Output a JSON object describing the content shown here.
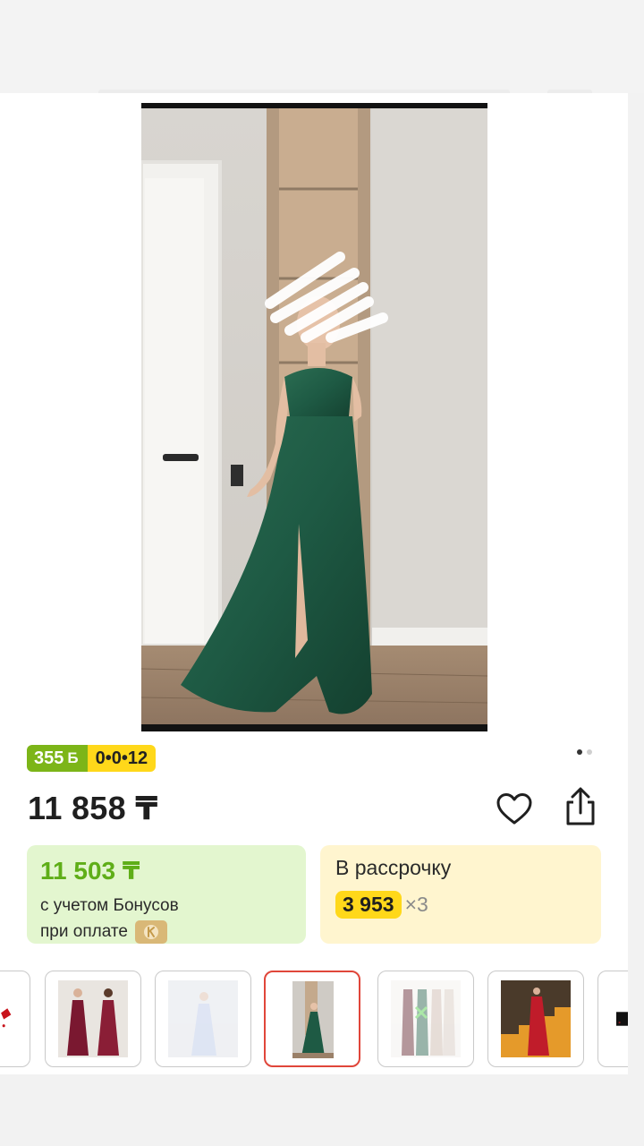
{
  "product": {
    "price": "11 858 ₸",
    "bonus_points": "355",
    "bonus_symbol": "Б",
    "installment_badge": "0•0•12"
  },
  "bonus_box": {
    "price": "11 503 ₸",
    "line1": "с учетом Бонусов",
    "line2": "при оплате"
  },
  "installment_box": {
    "label": "В рассрочку",
    "amount": "3 953",
    "multiplier": "×3"
  },
  "gallery": {
    "dot_count": 2,
    "active_dot": 0,
    "thumbnails": [
      {
        "name": "thumb-red-shoe",
        "selected": false
      },
      {
        "name": "thumb-burgundy-dress",
        "selected": false
      },
      {
        "name": "thumb-light-blue-dress",
        "selected": false
      },
      {
        "name": "thumb-green-dress",
        "selected": true
      },
      {
        "name": "thumb-colour-swatches",
        "selected": false
      },
      {
        "name": "thumb-red-dress-stairs",
        "selected": false
      },
      {
        "name": "thumb-dark-partial",
        "selected": false
      }
    ]
  },
  "colors": {
    "bonus_green": "#7cb518",
    "installment_yellow": "#ffd81a",
    "selected_border": "#e0463a",
    "dress_green": "#1e5a44"
  },
  "icons": {
    "favorite": "heart-icon",
    "share": "share-icon",
    "payment": "kaspi-icon"
  }
}
